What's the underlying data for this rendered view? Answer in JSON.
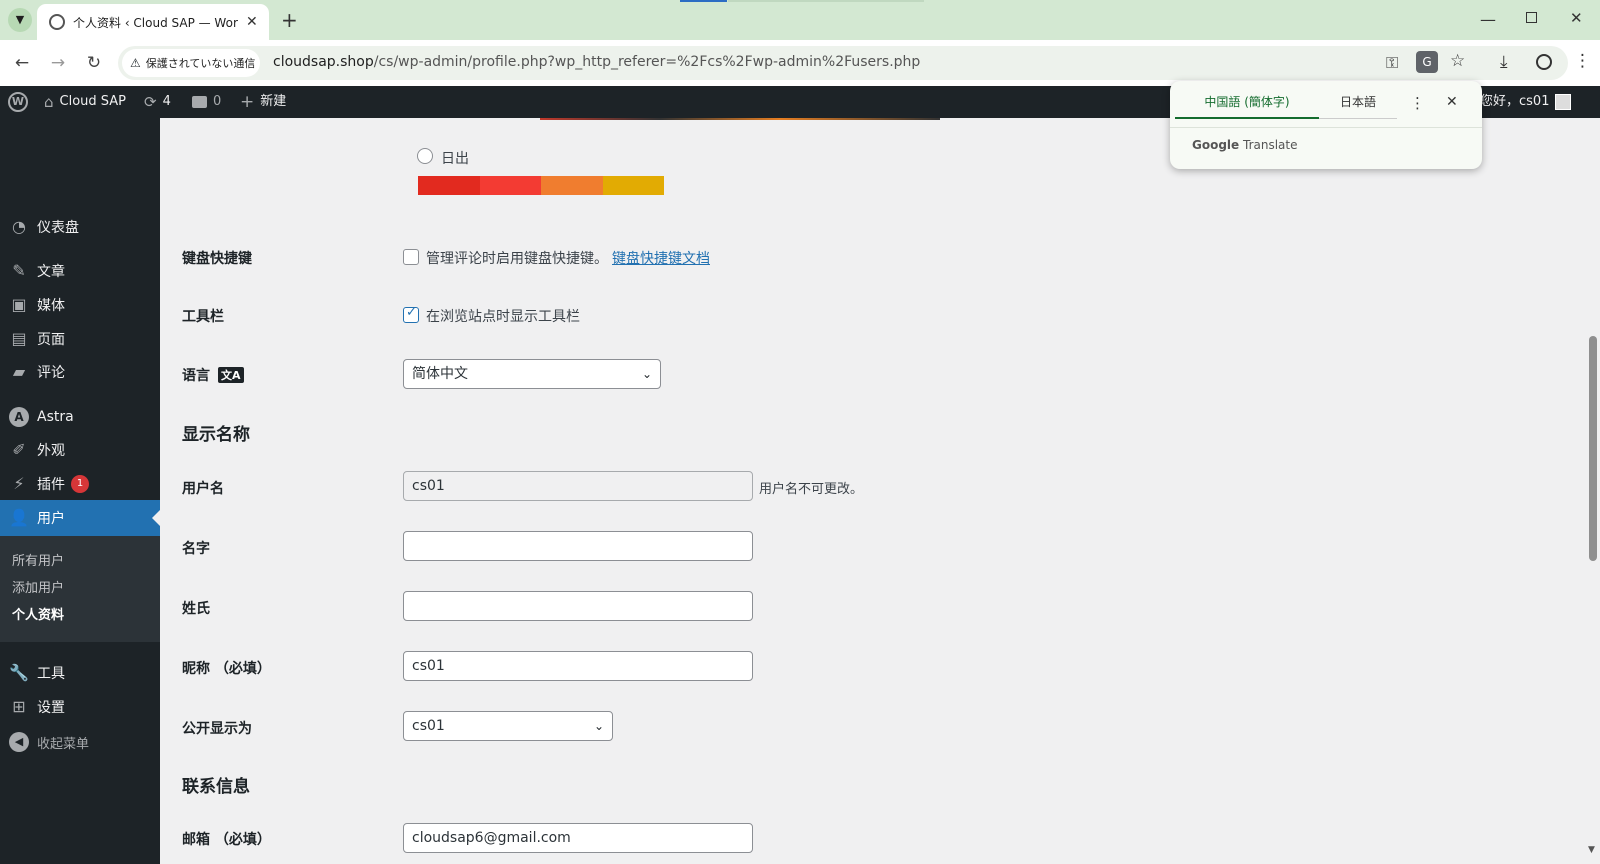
{
  "browser": {
    "tab_title": "个人资料 ‹ Cloud SAP — WordP",
    "security_label": "保護されていない通信",
    "url_domain": "cloudsap.shop",
    "url_path": "/cs/wp-admin/profile.php?wp_http_referer=%2Fcs%2Fwp-admin%2Fusers.php"
  },
  "adminbar": {
    "site_name": "Cloud SAP",
    "updates_count": "4",
    "comments_count": "0",
    "new_label": "新建",
    "greeting": "您好，cs01"
  },
  "translate_popup": {
    "tab_chinese": "中国語 (簡体字)",
    "tab_japanese": "日本語",
    "brand": "Google Translate",
    "brand_google": "Google",
    "brand_translate": "Translate"
  },
  "sidebar": {
    "items": [
      {
        "label": "仪表盘",
        "icon": "dashboard-icon"
      },
      {
        "label": "文章",
        "icon": "pin-icon"
      },
      {
        "label": "媒体",
        "icon": "media-icon"
      },
      {
        "label": "页面",
        "icon": "page-icon"
      },
      {
        "label": "评论",
        "icon": "comment-icon"
      },
      {
        "label": "Astra",
        "icon": "astra-icon"
      },
      {
        "label": "外观",
        "icon": "brush-icon"
      },
      {
        "label": "插件",
        "icon": "plugin-icon",
        "badge": "1"
      },
      {
        "label": "用户",
        "icon": "user-icon"
      },
      {
        "label": "工具",
        "icon": "wrench-icon"
      },
      {
        "label": "设置",
        "icon": "settings-icon"
      },
      {
        "label": "收起菜单",
        "icon": "collapse-icon"
      }
    ],
    "submenu": [
      "所有用户",
      "添加用户",
      "个人资料"
    ]
  },
  "content": {
    "color_scheme_option": "日出",
    "color_scheme_colors": [
      "#e22a1f",
      "#f33b33",
      "#f07d2f",
      "#e2ab03"
    ],
    "keyboard_label": "键盘快捷键",
    "keyboard_desc": "管理评论时启用键盘快捷键。",
    "keyboard_link": "键盘快捷键文档",
    "toolbar_label": "工具栏",
    "toolbar_desc": "在浏览站点时显示工具栏",
    "language_label": "语言",
    "language_value": "简体中文",
    "display_name_heading": "显示名称",
    "username_label": "用户名",
    "username_value": "cs01",
    "username_note": "用户名不可更改。",
    "firstname_label": "名字",
    "firstname_value": "",
    "lastname_label": "姓氏",
    "lastname_value": "",
    "nickname_label": "昵称 （必填）",
    "nickname_value": "cs01",
    "public_display_label": "公开显示为",
    "public_display_value": "cs01",
    "contact_heading": "联系信息",
    "email_label": "邮箱 （必填）",
    "email_value": "cloudsap6@gmail.com"
  },
  "colors": {
    "adminbar_bg": "#1d2327",
    "active_menu": "#2271b1",
    "badge": "#d63638",
    "link": "#2271b1"
  }
}
